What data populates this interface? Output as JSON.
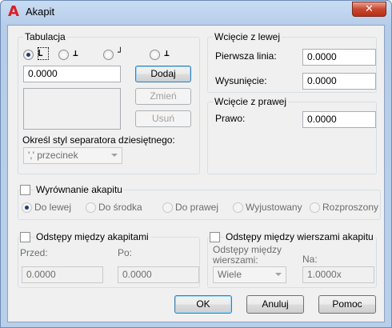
{
  "window": {
    "title": "Akapit",
    "close_glyph": "✕",
    "app_icon_glyph": "A"
  },
  "tabulacja": {
    "title": "Tabulacja",
    "tab_types": [
      {
        "name": "left-tab",
        "checked": true
      },
      {
        "name": "center-tab",
        "checked": false
      },
      {
        "name": "right-tab",
        "checked": false
      },
      {
        "name": "decimal-tab",
        "checked": false
      }
    ],
    "tab_value": "0.0000",
    "buttons": {
      "add": "Dodaj",
      "modify": "Zmień",
      "remove": "Usuń"
    },
    "separator_label": "Określ styl separatora dziesiętnego:",
    "separator_value": "',' przecinek"
  },
  "wciecie_lewe": {
    "title": "Wcięcie z lewej",
    "first_line_label": "Pierwsza linia:",
    "first_line_value": "0.0000",
    "hanging_label": "Wysunięcie:",
    "hanging_value": "0.0000"
  },
  "wciecie_prawe": {
    "title": "Wcięcie z prawej",
    "right_label": "Prawo:",
    "right_value": "0.0000"
  },
  "wyrownanie": {
    "title": "Wyrównanie akapitu",
    "options": [
      "Do lewej",
      "Do środka",
      "Do prawej",
      "Wyjustowany",
      "Rozproszony"
    ]
  },
  "odstepy_akapit": {
    "title": "Odstępy między akapitami",
    "before_label": "Przed:",
    "before_value": "0.0000",
    "after_label": "Po:",
    "after_value": "0.0000"
  },
  "odstepy_wiersze": {
    "title": "Odstępy między wierszami akapitu",
    "spacing_label_1": "Odstępy między",
    "spacing_label_2": "wierszami:",
    "spacing_value": "Wiele",
    "at_label": "Na:",
    "at_value": "1.0000x"
  },
  "footer": {
    "ok": "OK",
    "cancel": "Anuluj",
    "help": "Pomoc"
  }
}
